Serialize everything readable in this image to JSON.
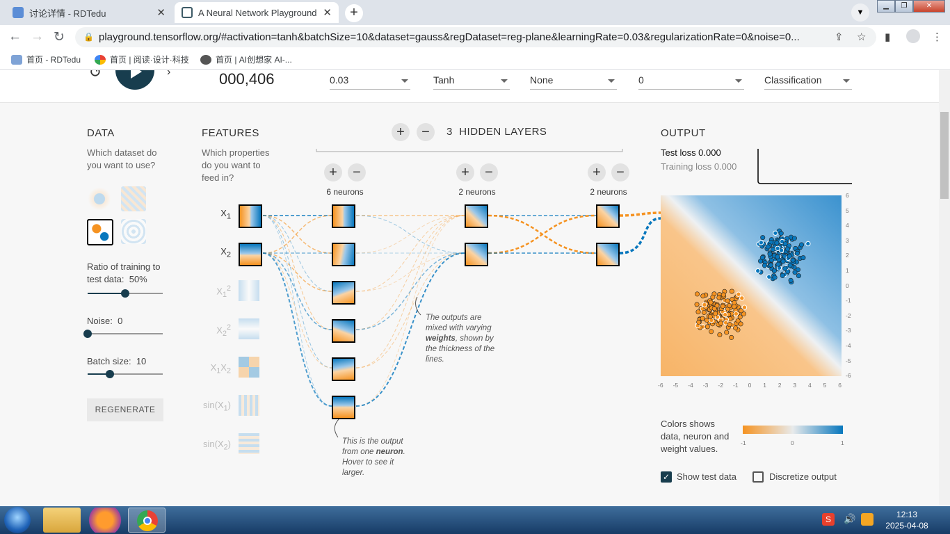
{
  "browser": {
    "tabs": [
      {
        "title": "讨论详情 - RDTedu",
        "active": false
      },
      {
        "title": "A Neural Network Playground",
        "active": true
      }
    ],
    "url": "playground.tensorflow.org/#activation=tanh&batchSize=10&dataset=gauss&regDataset=reg-plane&learningRate=0.03&regularizationRate=0&noise=0...",
    "bookmarks": [
      "首页 - RDTedu",
      "首页 | 阅读·设计·科技",
      "首页 | AI创想家 AI-..."
    ]
  },
  "controls": {
    "epoch": "000,406",
    "learning_rate": "0.03",
    "activation": "Tanh",
    "regularization": "None",
    "regularization_rate": "0",
    "problem_type": "Classification"
  },
  "data_panel": {
    "title": "DATA",
    "question": "Which dataset do you want to use?",
    "ratio_label": "Ratio of training to test data:",
    "ratio_value": "50%",
    "ratio_fraction": 0.5,
    "noise_label": "Noise:",
    "noise_value": "0",
    "noise_fraction": 0,
    "batch_label": "Batch size:",
    "batch_value": "10",
    "batch_fraction": 0.3,
    "regenerate": "REGENERATE"
  },
  "features_panel": {
    "title": "FEATURES",
    "question": "Which properties do you want to feed in?",
    "features": [
      "X1",
      "X2",
      "X1²",
      "X2²",
      "X1X2",
      "sin(X1)",
      "sin(X2)"
    ]
  },
  "network": {
    "hidden_layers_count": "3",
    "hidden_layers_label": "HIDDEN LAYERS",
    "layers": [
      {
        "neurons_label": "6 neurons"
      },
      {
        "neurons_label": "2 neurons"
      },
      {
        "neurons_label": "2 neurons"
      }
    ],
    "note_weights": [
      "The outputs are mixed with varying ",
      "weights",
      ", shown by the thickness of the lines."
    ],
    "note_neuron": [
      "This is the output from one ",
      "neuron",
      ". Hover to see it larger."
    ]
  },
  "output_panel": {
    "title": "OUTPUT",
    "test_loss": "Test loss 0.000",
    "training_loss": "Training loss 0.000",
    "y_ticks": [
      "6",
      "5",
      "4",
      "3",
      "2",
      "1",
      "0",
      "-1",
      "-2",
      "-3",
      "-4",
      "-5",
      "-6"
    ],
    "x_ticks": [
      "-6",
      "-5",
      "-4",
      "-3",
      "-2",
      "-1",
      "0",
      "1",
      "2",
      "3",
      "4",
      "5",
      "6"
    ],
    "legend_caption": "Colors shows data, neuron and weight values.",
    "legend_ticks": [
      "-1",
      "0",
      "1"
    ],
    "show_test_data": "Show test data",
    "show_test_data_checked": true,
    "discretize_output": "Discretize output",
    "discretize_checked": false,
    "colors": {
      "orange": "#f59322",
      "blue": "#0877bd",
      "dark": "#183d4e"
    }
  },
  "taskbar": {
    "time": "12:13",
    "date": "2025-04-08"
  }
}
